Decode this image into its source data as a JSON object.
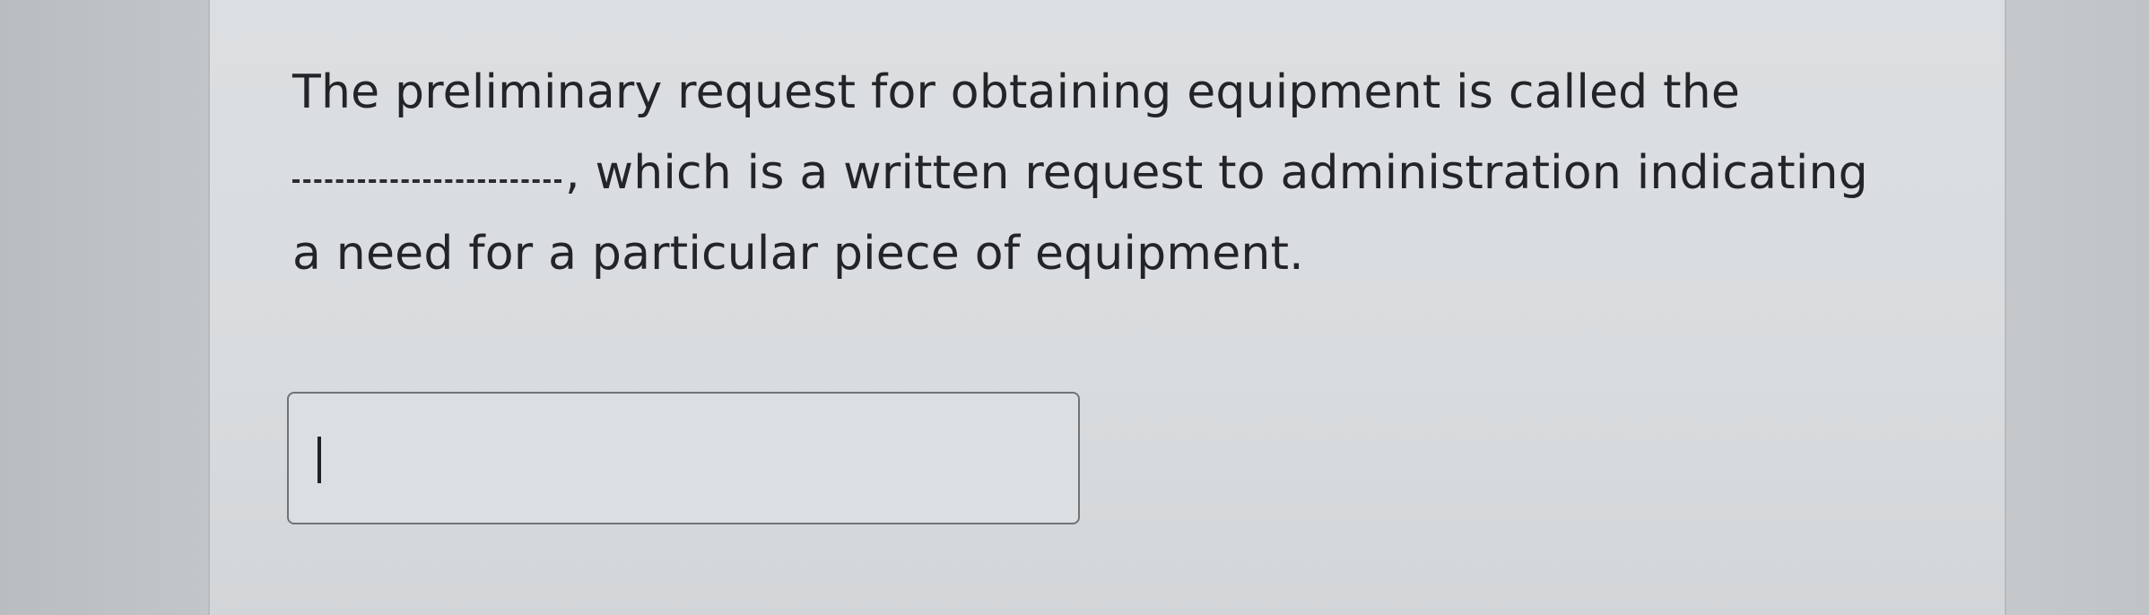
{
  "question": {
    "line1": "The preliminary request for obtaining equipment is called the",
    "line2_after_blank": ", which is a written request to administration indicating",
    "line3": "a need for a particular piece of equipment."
  },
  "answer_input": {
    "value": "",
    "placeholder": ""
  }
}
